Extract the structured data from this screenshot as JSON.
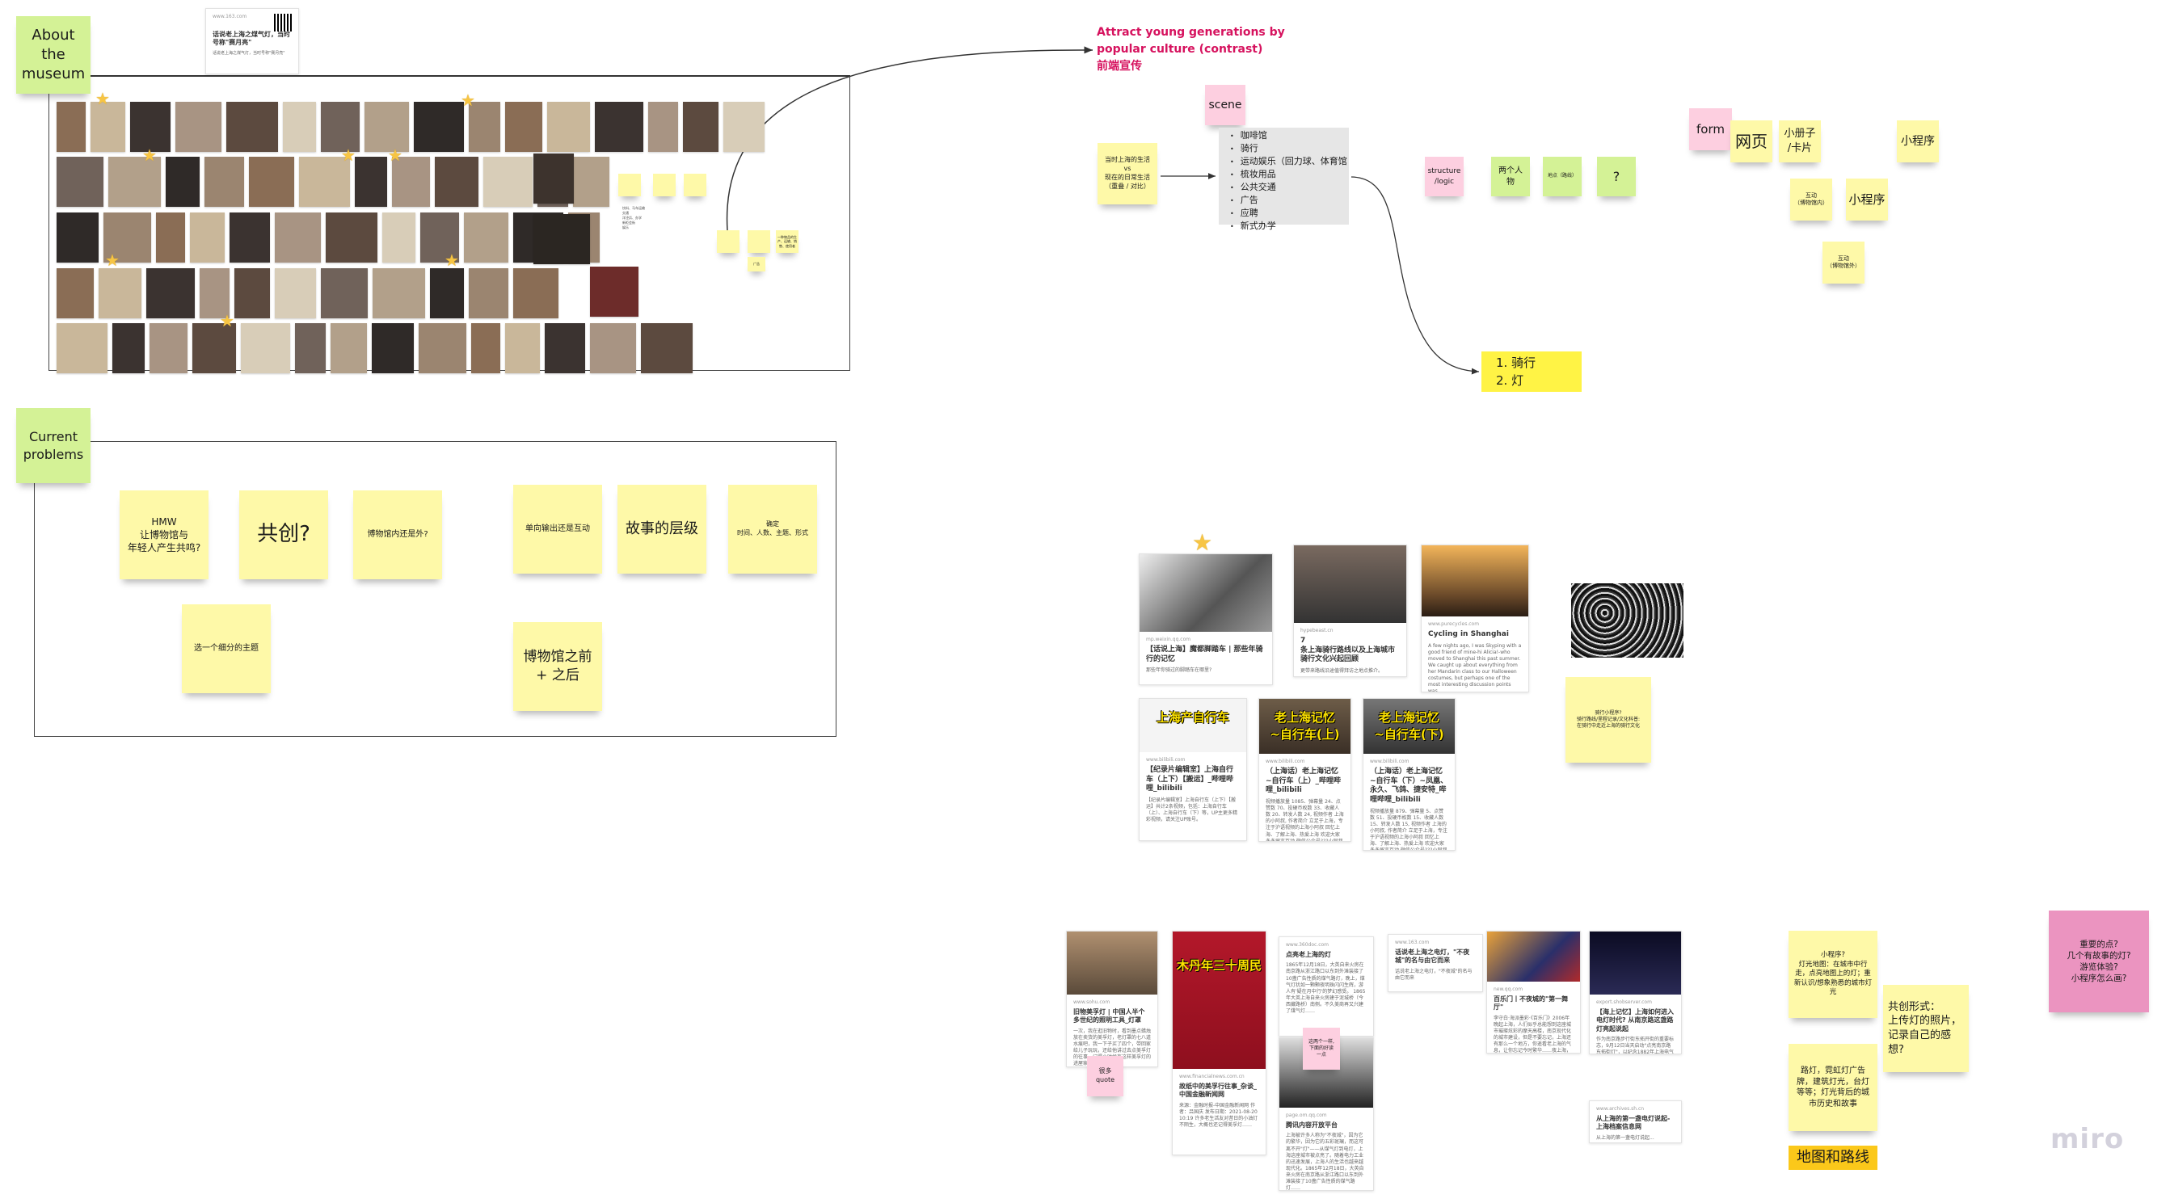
{
  "museum": {
    "title": "About\nthe\nmuseum",
    "top_card": {
      "source": "www.163.com",
      "title": "话说老上海之煤气灯，当时号称\"赛月亮\"",
      "desc": "话说老上海之煤气灯，当时号称\"赛月亮\""
    },
    "mini_notes": [
      "",
      "",
      "",
      "",
      "",
      "一种物品的生产、运输、销售、使用者",
      "广告"
    ],
    "bullets": [
      "饮料、马车运输",
      "交通",
      "洋泾浜、办学",
      "新柜会街",
      "娱乐"
    ]
  },
  "problems": {
    "title": "Current\nproblems",
    "notes": [
      "HMW\n让博物馆与\n年轻人产生共鸣?",
      "共创?",
      "博物馆内还是外?",
      "单向输出还是互动",
      "故事的层级",
      "确定\n时间、人数、主题、形式",
      "选一个细分的主题",
      "博物馆之前\n+ 之后"
    ]
  },
  "headline": {
    "line1": "Attract young generations by",
    "line2": "popular culture (contrast)",
    "line3": "前端宣传",
    "color": "#d6125e"
  },
  "scene": {
    "label": "scene",
    "compare_note": "当时上海的生活\nvs\n现在的日常生活\n（重叠 / 对比）",
    "items": [
      "咖啡馆",
      "骑行",
      "运动娱乐（回力球、体育馆",
      "梳妆用品",
      "公共交通",
      "广告",
      "应聘",
      "新式办学"
    ],
    "structure": "structure\n/logic",
    "two_people": "两个人物",
    "location": "地点（路线）",
    "question": "?",
    "result": [
      "1. 骑行",
      "2. 灯"
    ]
  },
  "form": {
    "label": "form",
    "notes": [
      "网页",
      "小册子\n/卡片",
      "小程序",
      "互动\n（博物馆内）",
      "小程序",
      "互动\n（博物馆外）"
    ]
  },
  "cycling_cards": [
    {
      "source": "mp.weixin.qq.com",
      "title": "【话说上海】魔都脚踏车 | 那些年骑行的记忆",
      "desc": "那些年你骑过的脚踏车在哪里?"
    },
    {
      "source": "hypebeast.cn",
      "title": "7\n条上海骑行路线以及上海城市骑行文化兴起回顾",
      "desc": "更带来路线沿途值得拜访之地点推介。"
    },
    {
      "source": "www.purecycles.com",
      "title": "Cycling in Shanghai",
      "desc": "A few nights ago, I was Skyping with a good friend of mine-hi Alicia!-who moved to Shanghai this past summer. We caught up about everything from her Mandarin class to our Halloween costumes, but perhaps one of the most interesting discussion points was ..."
    },
    {
      "source": "www.bilibili.com",
      "title": "【纪录片编辑室】上海自行车（上下）【搬运】_哔哩哔哩_bilibili",
      "desc": "【纪录片编辑室】上海自行车（上下）【搬运】共计2条视频，包括：上海自行车（上）、上海自行车（下）等，UP主更多精彩视频，请关注UP账号。",
      "banner": "上海产自行车"
    },
    {
      "source": "www.bilibili.com",
      "title": "（上海话）老上海记忆~自行车（上）_哔哩哔哩_bilibili",
      "desc": "视频播放量 1085、弹幕量 24、点赞数 70、投硬币枚数 33、收藏人数 20、转发人数 24, 视频作者 上海的小阿叔, 作者简介 立足于上海，专注于沪语视频的上海小阿叔 回忆上海、了解上海、热爱上海 欢迎大家多多留言互动 微信公众号???小阿叔聊沪 ...",
      "banner": "老上海记忆\n~自行车(上)"
    },
    {
      "source": "www.bilibili.com",
      "title": "（上海话）老上海记忆~自行车（下）~凤凰、永久、飞鸽、捷安特_哔哩哔哩_bilibili",
      "desc": "视频播放量 879、弹幕量 5、点赞数 51、投硬币枚数 15、收藏人数 15、转发人数 15, 视频作者 上海的小阿叔, 作者简介 立足于上海，专注于沪语视频的上海小阿叔 回忆上海、了解上海、热爱上海 欢迎大家多多留言互动 微信公众号???小阿叔聊沪 ...",
      "banner": "老上海记忆\n~自行车(下)"
    }
  ],
  "cycling_note": "骑行小程序?\n骑行路线/里程记录/文化科普:\n在骑行中走近上海的骑行文化",
  "light_cards": [
    {
      "source": "www.sohu.com",
      "title": "旧物美孚灯 | 中国人半个多世纪的照明工具_灯罩",
      "desc": "一次，我在逛旧物时，看到墨点蜡烛放在卖货的美孚灯，老灯罩的七八道水痕吧，我一下子买了四个，带回家给儿子玩玩，还给他讲过去点美孚灯的往事，记得小时候有这样美孚灯的进屋家里条件好的......"
    },
    {
      "source": "www.financialnews.com.cn",
      "title": "故纸中的美孚行往事_杂谈_中国金融新闻网",
      "desc": "来源：金融时报-中国金融新闻网 作者：吕国庆 发布日期：2021-08-20 10:19 许多老生活友对昔日的小油灯不陌生，大概也还记得美孚灯……",
      "banner": "木丹年三十周民"
    },
    {
      "source": "www.360doc.com",
      "title": "点亮老上海的灯",
      "desc": "1865年12月18日，大英自来火房在南京路从浙江路口以东到外滩装接了10盏广告性质的煤气路灯，晚上，煤气灯犹如一颗颗夜明珠闪闪生辉，游人有'疑在月中行'的梦幻感受。 1865年大英上海自来火房建于泥城桥（今西藏路桥）南侧。不久美商再又兴建了煤气灯……"
    },
    {
      "source": "page.om.qq.com",
      "title": "腾讯内容开放平台",
      "desc": "上海被许多人称为\"不夜城\"，因为它的繁华，因为它的五彩斑斓，而这可离不开\"灯\"——从煤气灯到电灯，上海这座城市被点亮了。随着电力工业的迅速发展，上海人的生活也越来越现代化。1865年12月18日，大英自来火房在南京路从浙江路口以东到外滩装接了10盏广告性质的煤气路灯……"
    },
    {
      "source": "www.163.com",
      "title": "话说老上海之电灯，\"不夜城\"的名与由它而来",
      "desc": "话说老上海之电灯，\"不夜城\"的名与由它而来"
    },
    {
      "source": "new.qq.com",
      "title": "百乐门丨不夜城的\"第一舞厅\"",
      "desc": "李守白·海派墨彩·《百乐门》2006年 晚起上海，人们似乎总能想到这座城市璀璨炫彩的摩天高楼，南京现代化的城市建设，但是不要忘记，上海还有那么一个地方，你遥看老上海的气息，让你忘记今时繁华……夜上海，夜上海，你是个不夜城……"
    },
    {
      "source": "export.shobserver.com",
      "title": "【海上记忆】上海如何进入电灯时代? 从南京路这盏路灯亮起说起",
      "desc": "作为南京路步行街东拓开街的重要标志，9月12日当天启动\"点亮南京路东拓街灯\"，以纪念1882年上海电气公司在南京路点亮第一盏电灯。（陈抒 摄）..."
    },
    {
      "source": "www.archives.sh.cn",
      "title": "从上海的第一盏电灯说起-上海档案信息网",
      "desc": "从上海的第一盏电灯说起..."
    }
  ],
  "light_stickies": {
    "quote": "很多quote",
    "compare": "这两个一样,\n下面的好读一点"
  },
  "ideas": {
    "mini_program": "小程序?\n灯光地图：在城市中行走，点亮地图上的灯；重新认识/想象熟悉的城市灯光",
    "cocreate": "共创形式：\n上传灯的照片，记录自己的感想?",
    "lights": "路灯，霓虹灯广告牌，建筑灯光，台灯等等；灯光背后的城市历史和故事",
    "map_route": "地图和路线",
    "questions": "重要的点?\n几个有故事的灯?\n游览体验?\n小程序怎么画?"
  },
  "brand": {
    "logo_text": "miro"
  }
}
